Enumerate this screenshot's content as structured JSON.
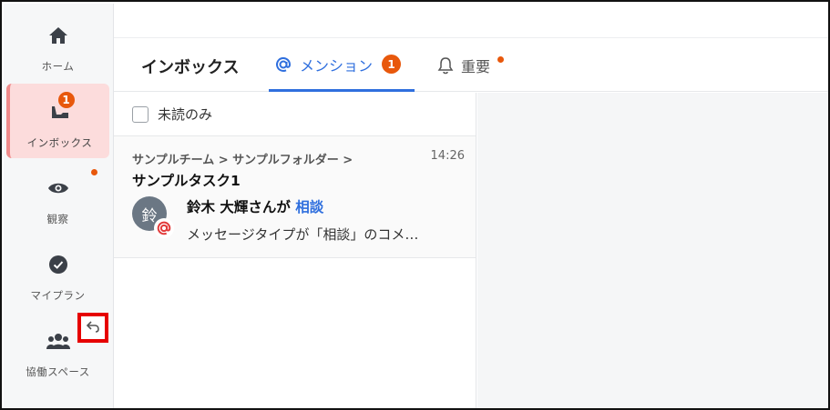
{
  "sidebar": {
    "items": [
      {
        "label": "ホーム",
        "icon": "home-icon"
      },
      {
        "label": "インボックス",
        "icon": "inbox-icon",
        "badge": "1"
      },
      {
        "label": "観察",
        "icon": "eye-icon"
      },
      {
        "label": "マイプラン",
        "icon": "check-circle-icon"
      },
      {
        "label": "協働スペース",
        "icon": "team-icon"
      }
    ],
    "undo_icon": "undo-icon"
  },
  "tabs": {
    "title": "インボックス",
    "mention_label": "メンション",
    "mention_badge": "1",
    "important_label": "重要"
  },
  "filter": {
    "label": "未読のみ"
  },
  "messages": [
    {
      "breadcrumb": "サンプルチーム > サンプルフォルダー >",
      "time": "14:26",
      "task": "サンプルタスク1",
      "avatar_text": "鈴",
      "sender_prefix": "鈴木 大輝さんが ",
      "type": "相談",
      "preview": "メッセージタイプが「相談」のコメ…"
    }
  ],
  "colors": {
    "accent": "#2f6fde",
    "badge": "#e8580c",
    "active_bg": "#fcdcdc",
    "mention": "#e23a3a"
  }
}
